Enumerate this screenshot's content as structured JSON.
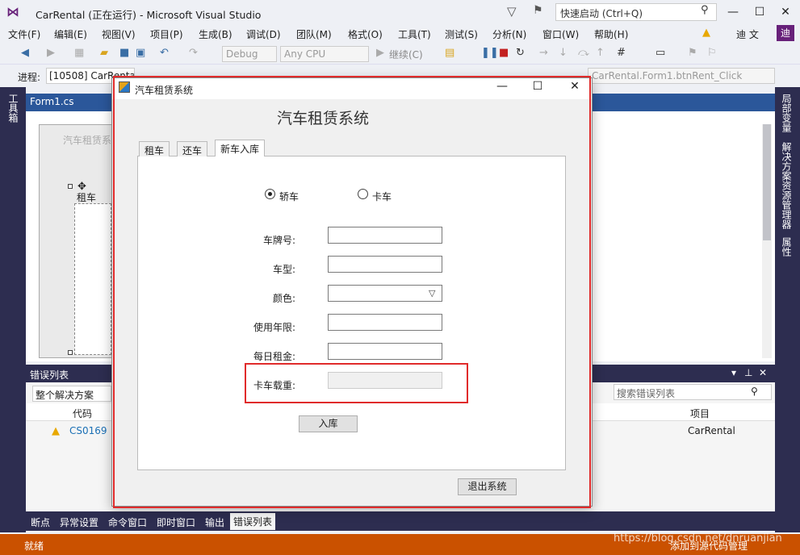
{
  "window": {
    "title": "CarRental (正在运行) - Microsoft Visual Studio",
    "quick_launch": "快速启动 (Ctrl+Q)"
  },
  "menu": [
    "文件(F)",
    "编辑(E)",
    "视图(V)",
    "项目(P)",
    "生成(B)",
    "调试(D)",
    "团队(M)",
    "格式(O)",
    "工具(T)",
    "测试(S)",
    "分析(N)",
    "窗口(W)",
    "帮助(H)"
  ],
  "user": {
    "name": "迪 文",
    "badge": "迪"
  },
  "toolbar": {
    "config": "Debug",
    "platform": "Any CPU",
    "continue": "继续(C)"
  },
  "process": {
    "label": "进程:",
    "value": "[10508] CarRental.exe",
    "event": "CarRental.Form1.btnRent_Click"
  },
  "left_rail": {
    "toolbox": "工具箱"
  },
  "right_rail": {
    "locals": "局部变量",
    "solution": "解决方案资源管理器",
    "properties": "属性"
  },
  "editor": {
    "tab": "Form1.cs",
    "designer_title": "汽车租赁系",
    "designer_tab": "租车"
  },
  "error_list": {
    "title": "错误列表",
    "scope": "整个解决方案",
    "search_placeholder": "搜索错误列表",
    "col_code": "代码",
    "col_project": "项目",
    "row": {
      "code": "CS0169",
      "project": "CarRental"
    }
  },
  "bottom_tabs": [
    "断点",
    "异常设置",
    "命令窗口",
    "即时窗口",
    "输出",
    "错误列表"
  ],
  "status": {
    "ready": "就绪",
    "source": "添加到源代码管理"
  },
  "watermark": "https://blog.csdn.net/dnruanjian",
  "app": {
    "title": "汽车租赁系统",
    "heading": "汽车租赁系统",
    "tabs": [
      "租车",
      "还车",
      "新车入库"
    ],
    "radio_car": "轿车",
    "radio_truck": "卡车",
    "labels": {
      "plate": "车牌号:",
      "model": "车型:",
      "color": "颜色:",
      "years": "使用年限:",
      "rent": "每日租金:",
      "load": "卡车载重:"
    },
    "btn_add": "入库",
    "btn_exit": "退出系统"
  }
}
